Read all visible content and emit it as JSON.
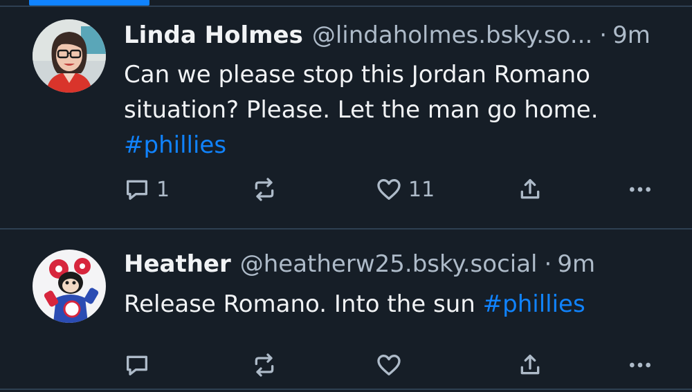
{
  "colors": {
    "background": "#161e27",
    "divider": "#2e4052",
    "accent": "#1083fe",
    "text": "#f1f3f5",
    "muted": "#aebbc9"
  },
  "posts": [
    {
      "name": "Linda Holmes",
      "handle": "@lindaholmes.bsky.so...",
      "dot": "·",
      "time": "9m",
      "text_line1": "Can we please stop this Jordan Romano",
      "text_line2": "situation? Please. Let the man go home.",
      "hashtag": "#phillies",
      "reply_count": "1",
      "repost_count": "",
      "like_count": "11",
      "icons": [
        "reply-icon",
        "repost-icon",
        "like-icon",
        "share-icon",
        "more-icon"
      ]
    },
    {
      "name": "Heather",
      "handle": "@heatherw25.bsky.social",
      "dot": "·",
      "time": "9m",
      "text": "Release Romano. Into the sun ",
      "hashtag": "#phillies",
      "reply_count": "",
      "repost_count": "",
      "like_count": "",
      "icons": [
        "reply-icon",
        "repost-icon",
        "like-icon",
        "share-icon",
        "more-icon"
      ]
    }
  ]
}
